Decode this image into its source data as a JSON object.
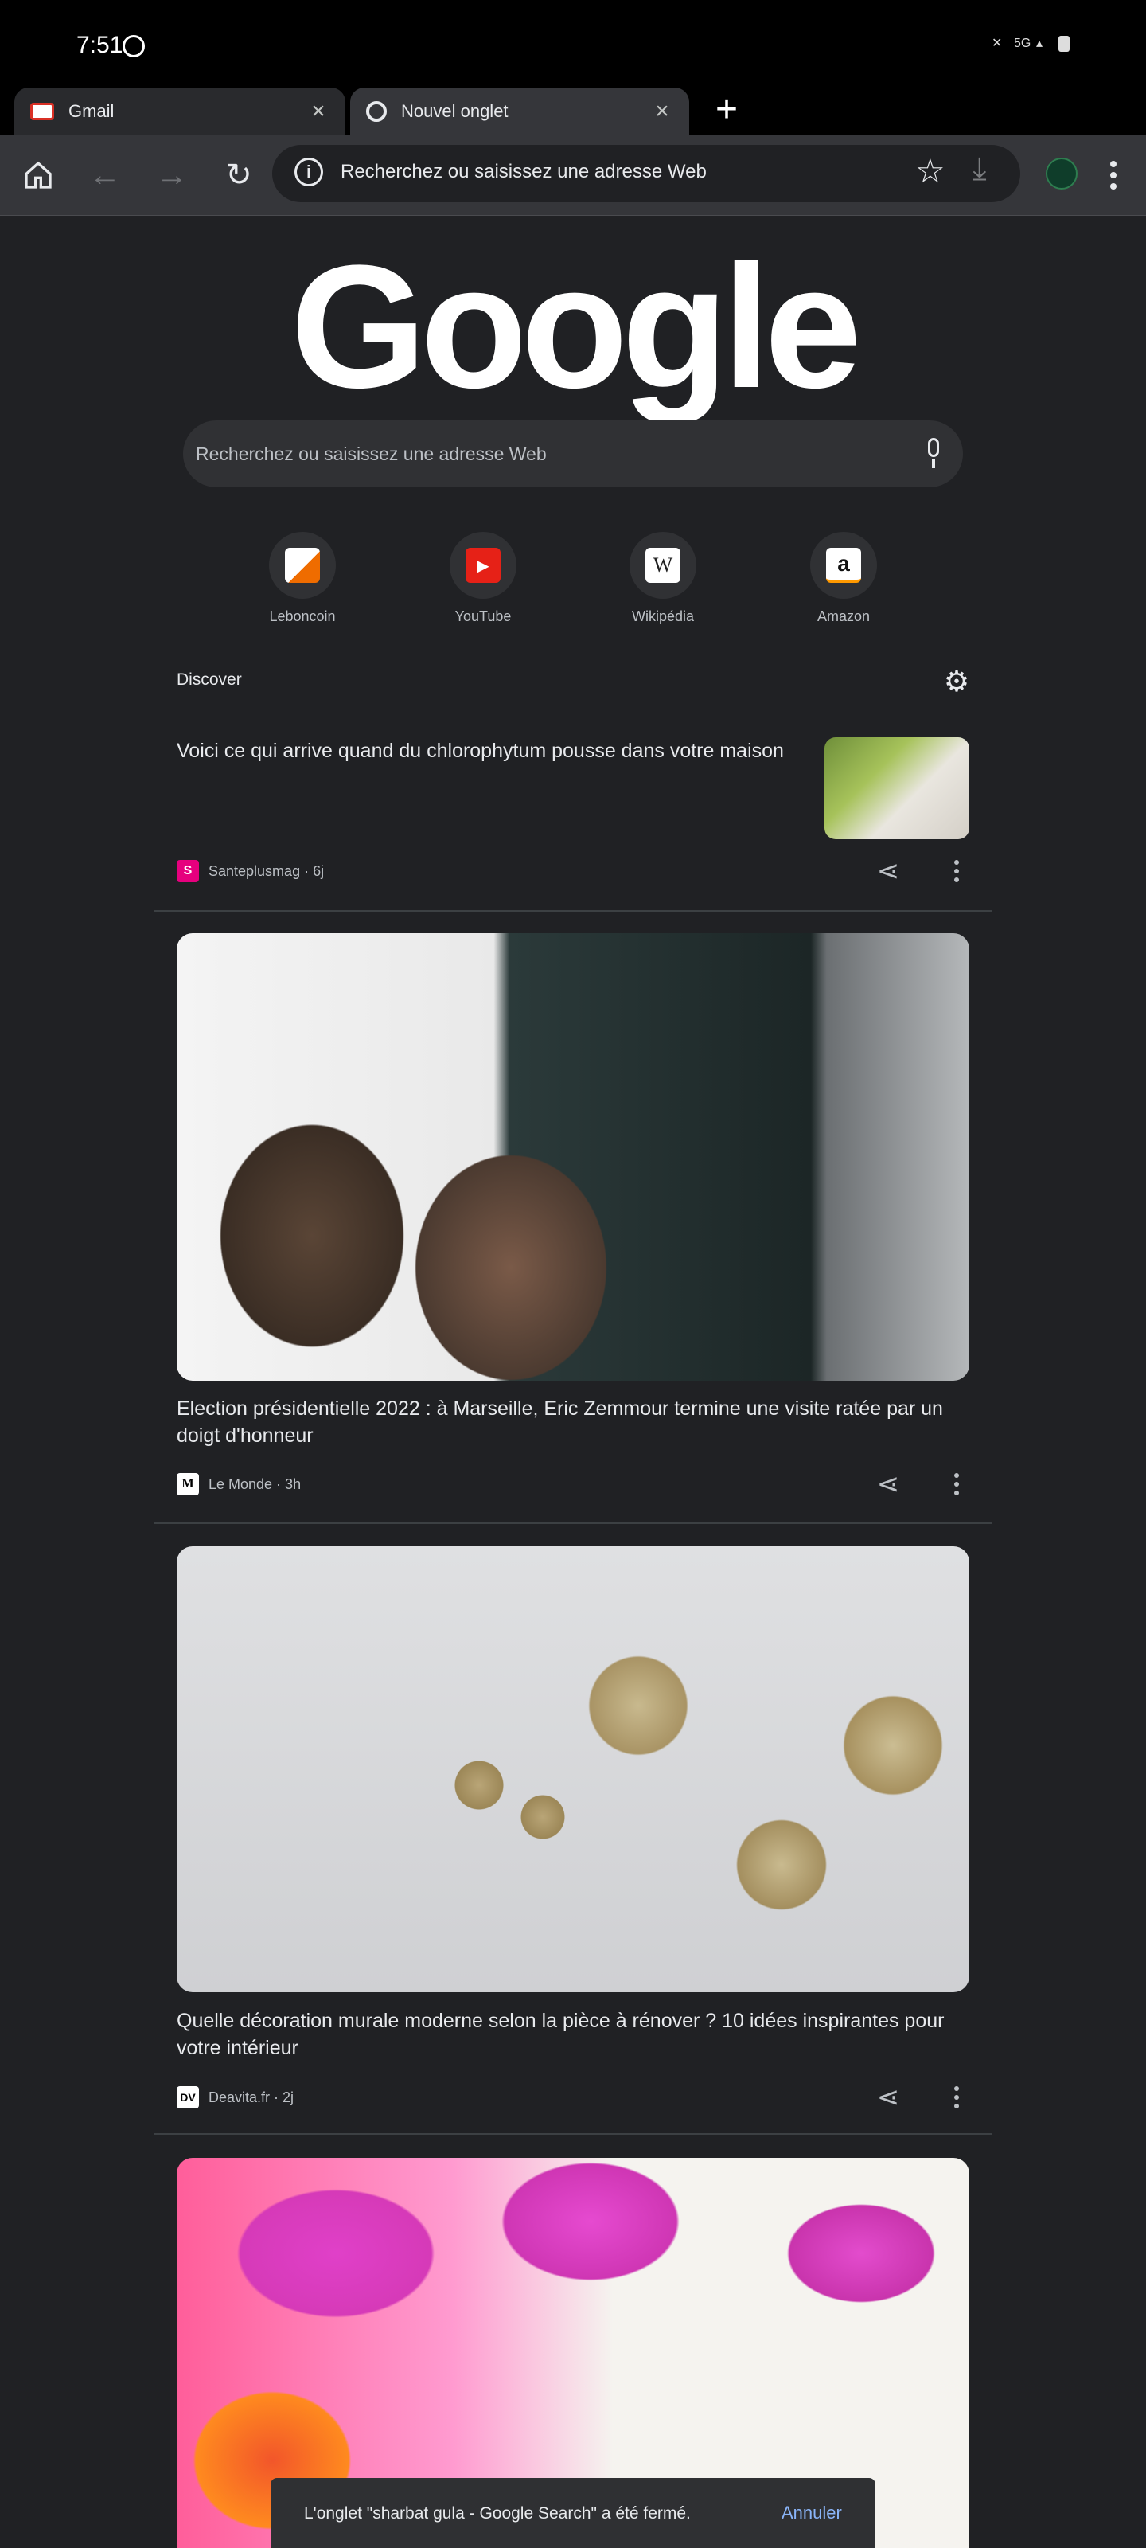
{
  "status_bar": {
    "time": "7:51",
    "network": "5G"
  },
  "tabs": [
    {
      "label": "Gmail"
    },
    {
      "label": "Nouvel onglet"
    }
  ],
  "toolbar": {
    "omnibox_text": "Recherchez ou saisissez une adresse Web"
  },
  "logo": {
    "text": "Google"
  },
  "search": {
    "placeholder": "Recherchez ou saisissez une adresse Web"
  },
  "shortcuts": [
    {
      "label": "Leboncoin"
    },
    {
      "label": "YouTube"
    },
    {
      "label": "Wikipédia"
    },
    {
      "label": "Amazon"
    }
  ],
  "discover": {
    "label": "Discover",
    "articles": [
      {
        "title": "Voici ce qui arrive quand du chlorophytum pousse dans votre maison",
        "source": "Santeplusmag · 6j"
      },
      {
        "title": "Election présidentielle 2022 : à Marseille, Eric Zemmour termine une visite ratée par un doigt d'honneur",
        "source": "Le Monde · 3h"
      },
      {
        "title": "Quelle décoration murale moderne selon la pièce à rénover ? 10 idées inspirantes pour votre intérieur",
        "source": "Deavita.fr · 2j"
      }
    ]
  },
  "snackbar": {
    "text": "L'onglet \"sharbat gula - Google Search\" a été fermé.",
    "action": "Annuler"
  }
}
